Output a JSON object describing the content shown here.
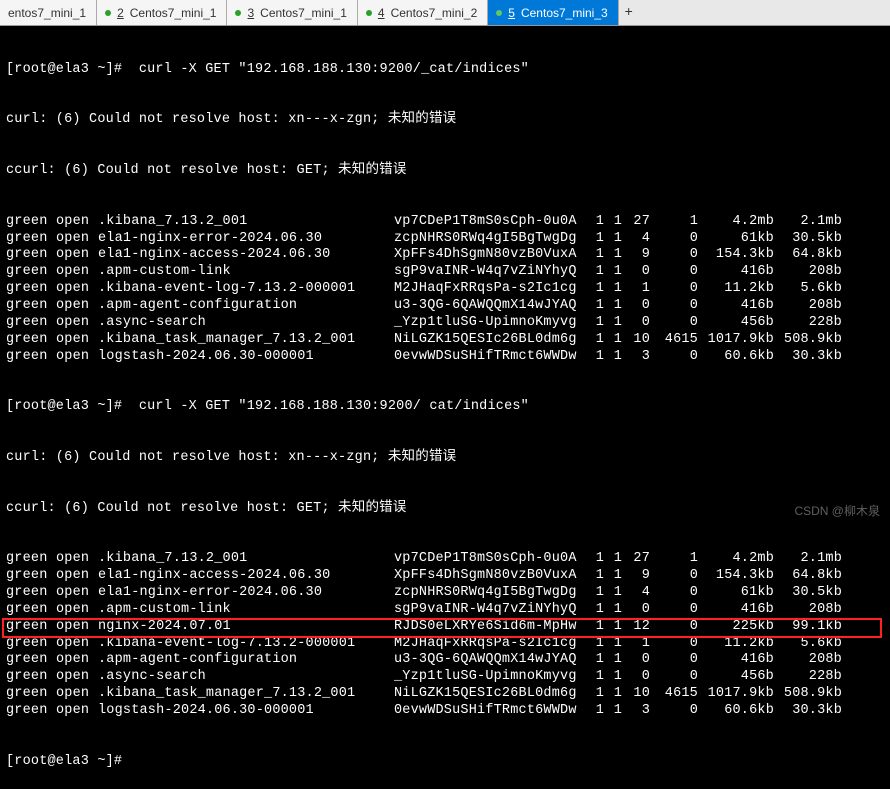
{
  "tabs": [
    {
      "label": "entos7_mini_1",
      "num": ""
    },
    {
      "label": "Centos7_mini_1",
      "num": "2"
    },
    {
      "label": "Centos7_mini_1",
      "num": "3"
    },
    {
      "label": "Centos7_mini_2",
      "num": "4"
    },
    {
      "label": "Centos7_mini_3",
      "num": "5"
    }
  ],
  "prompt1": "[root@ela3 ~]#  curl -X GET \"192.168.188.130:9200/_cat/indices\"",
  "err1": "curl: (6) Could not resolve host: xn---x-zgn; 未知的错误",
  "err2": "ccurl: (6) Could not resolve host: GET; 未知的错误",
  "prompt2": "[root@ela3 ~]#  curl -X GET \"192.168.188.130:9200/ cat/indices\"",
  "prompt3": "[root@ela3 ~]#",
  "block1": [
    {
      "st": "green",
      "md": "open",
      "nm": ".kibana_7.13.2_001",
      "id": "vp7CDeP1T8mS0sCph-0u0A",
      "a": "1",
      "b": "1",
      "c": "27",
      "d": "1",
      "s1": "4.2mb",
      "s2": "2.1mb"
    },
    {
      "st": "green",
      "md": "open",
      "nm": "ela1-nginx-error-2024.06.30",
      "id": "zcpNHRS0RWq4gI5BgTwgDg",
      "a": "1",
      "b": "1",
      "c": "4",
      "d": "0",
      "s1": "61kb",
      "s2": "30.5kb"
    },
    {
      "st": "green",
      "md": "open",
      "nm": "ela1-nginx-access-2024.06.30",
      "id": "XpFFs4DhSgmN80vzB0VuxA",
      "a": "1",
      "b": "1",
      "c": "9",
      "d": "0",
      "s1": "154.3kb",
      "s2": "64.8kb"
    },
    {
      "st": "green",
      "md": "open",
      "nm": ".apm-custom-link",
      "id": "sgP9vaINR-W4q7vZiNYhyQ",
      "a": "1",
      "b": "1",
      "c": "0",
      "d": "0",
      "s1": "416b",
      "s2": "208b"
    },
    {
      "st": "green",
      "md": "open",
      "nm": ".kibana-event-log-7.13.2-000001",
      "id": "M2JHaqFxRRqsPa-s2Ic1cg",
      "a": "1",
      "b": "1",
      "c": "1",
      "d": "0",
      "s1": "11.2kb",
      "s2": "5.6kb"
    },
    {
      "st": "green",
      "md": "open",
      "nm": ".apm-agent-configuration",
      "id": "u3-3QG-6QAWQQmX14wJYAQ",
      "a": "1",
      "b": "1",
      "c": "0",
      "d": "0",
      "s1": "416b",
      "s2": "208b"
    },
    {
      "st": "green",
      "md": "open",
      "nm": ".async-search",
      "id": "_Yzp1tluSG-UpimnoKmyvg",
      "a": "1",
      "b": "1",
      "c": "0",
      "d": "0",
      "s1": "456b",
      "s2": "228b"
    },
    {
      "st": "green",
      "md": "open",
      "nm": ".kibana_task_manager_7.13.2_001",
      "id": "NiLGZK15QESIc26BL0dm6g",
      "a": "1",
      "b": "1",
      "c": "10",
      "d": "4615",
      "s1": "1017.9kb",
      "s2": "508.9kb"
    },
    {
      "st": "green",
      "md": "open",
      "nm": "logstash-2024.06.30-000001",
      "id": "0evwWDSuSHifTRmct6WWDw",
      "a": "1",
      "b": "1",
      "c": "3",
      "d": "0",
      "s1": "60.6kb",
      "s2": "30.3kb"
    }
  ],
  "block2": [
    {
      "st": "green",
      "md": "open",
      "nm": ".kibana_7.13.2_001",
      "id": "vp7CDeP1T8mS0sCph-0u0A",
      "a": "1",
      "b": "1",
      "c": "27",
      "d": "1",
      "s1": "4.2mb",
      "s2": "2.1mb"
    },
    {
      "st": "green",
      "md": "open",
      "nm": "ela1-nginx-access-2024.06.30",
      "id": "XpFFs4DhSgmN80vzB0VuxA",
      "a": "1",
      "b": "1",
      "c": "9",
      "d": "0",
      "s1": "154.3kb",
      "s2": "64.8kb"
    },
    {
      "st": "green",
      "md": "open",
      "nm": "ela1-nginx-error-2024.06.30",
      "id": "zcpNHRS0RWq4gI5BgTwgDg",
      "a": "1",
      "b": "1",
      "c": "4",
      "d": "0",
      "s1": "61kb",
      "s2": "30.5kb"
    },
    {
      "st": "green",
      "md": "open",
      "nm": ".apm-custom-link",
      "id": "sgP9vaINR-W4q7vZiNYhyQ",
      "a": "1",
      "b": "1",
      "c": "0",
      "d": "0",
      "s1": "416b",
      "s2": "208b"
    },
    {
      "st": "green",
      "md": "open",
      "nm": "nginx-2024.07.01",
      "id": "RJDS0eLXRYe6Sid6m-MpHw",
      "a": "1",
      "b": "1",
      "c": "12",
      "d": "0",
      "s1": "225kb",
      "s2": "99.1kb"
    },
    {
      "st": "green",
      "md": "open",
      "nm": ".kibana-event-log-7.13.2-000001",
      "id": "M2JHaqFxRRqsPa-s2Ic1cg",
      "a": "1",
      "b": "1",
      "c": "1",
      "d": "0",
      "s1": "11.2kb",
      "s2": "5.6kb"
    },
    {
      "st": "green",
      "md": "open",
      "nm": ".apm-agent-configuration",
      "id": "u3-3QG-6QAWQQmX14wJYAQ",
      "a": "1",
      "b": "1",
      "c": "0",
      "d": "0",
      "s1": "416b",
      "s2": "208b"
    },
    {
      "st": "green",
      "md": "open",
      "nm": ".async-search",
      "id": "_Yzp1tluSG-UpimnoKmyvg",
      "a": "1",
      "b": "1",
      "c": "0",
      "d": "0",
      "s1": "456b",
      "s2": "228b"
    },
    {
      "st": "green",
      "md": "open",
      "nm": ".kibana_task_manager_7.13.2_001",
      "id": "NiLGZK15QESIc26BL0dm6g",
      "a": "1",
      "b": "1",
      "c": "10",
      "d": "4615",
      "s1": "1017.9kb",
      "s2": "508.9kb"
    },
    {
      "st": "green",
      "md": "open",
      "nm": "logstash-2024.06.30-000001",
      "id": "0evwWDSuSHifTRmct6WWDw",
      "a": "1",
      "b": "1",
      "c": "3",
      "d": "0",
      "s1": "60.6kb",
      "s2": "30.3kb"
    }
  ],
  "highlight_row_index": 4,
  "watermark": "CSDN @柳木泉"
}
